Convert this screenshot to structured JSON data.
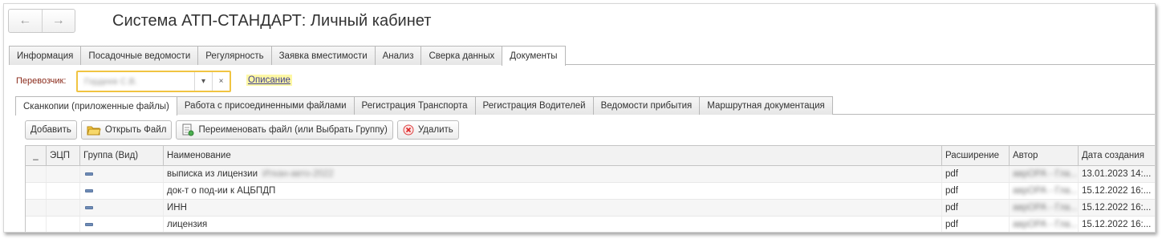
{
  "header": {
    "title": "Система АТП-СТАНДАРТ: Личный кабинет",
    "back_glyph": "←",
    "forward_glyph": "→"
  },
  "main_tabs": [
    {
      "label": "Информация",
      "active": false
    },
    {
      "label": "Посадочные ведомости",
      "active": false
    },
    {
      "label": "Регулярность",
      "active": false
    },
    {
      "label": "Заявка вместимости",
      "active": false
    },
    {
      "label": "Анализ",
      "active": false
    },
    {
      "label": "Сверка данных",
      "active": false
    },
    {
      "label": "Документы",
      "active": true
    }
  ],
  "carrier": {
    "label": "Перевозчик:",
    "value": "Гордеев С.В.",
    "dropdown_glyph": "▾",
    "clear_glyph": "×",
    "description_link": "Описание"
  },
  "sub_tabs": [
    {
      "label": "Сканкопии (приложенные файлы)",
      "active": true
    },
    {
      "label": "Работа с присоединенными файлами",
      "active": false
    },
    {
      "label": "Регистрация Транспорта",
      "active": false
    },
    {
      "label": "Регистрация Водителей",
      "active": false
    },
    {
      "label": "Ведомости прибытия",
      "active": false
    },
    {
      "label": "Маршрутная документация",
      "active": false
    }
  ],
  "toolbar": {
    "add": "Добавить",
    "open_file": "Открыть Файл",
    "rename": "Переименовать файл (или Выбрать Группу)",
    "delete": "Удалить"
  },
  "table": {
    "columns": [
      "_",
      "ЭЦП",
      "Группа (Вид)",
      "Наименование",
      "Расширение",
      "Автор",
      "Дата создания"
    ],
    "rows": [
      {
        "name": "выписка из лицензии",
        "name_extra": "Иткан-авто-2022",
        "ext": "pdf",
        "author": "аврОРА - Гла...",
        "date": "13.01.2023 14:..."
      },
      {
        "name": "док-т о под-ии к АЦБПДП",
        "name_extra": "",
        "ext": "pdf",
        "author": "аврОРА - Гла...",
        "date": "15.12.2022 16:..."
      },
      {
        "name": "ИНН",
        "name_extra": "",
        "ext": "pdf",
        "author": "аврОРА - Гла...",
        "date": "15.12.2022 16:..."
      },
      {
        "name": "лицензия",
        "name_extra": "",
        "ext": "pdf",
        "author": "аврОРА - Гла...",
        "date": "15.12.2022 16:..."
      }
    ]
  },
  "colors": {
    "field_highlight": "#f0c442",
    "link_highlight": "#fdf7a5",
    "group_icon": "#6f8cb7"
  }
}
